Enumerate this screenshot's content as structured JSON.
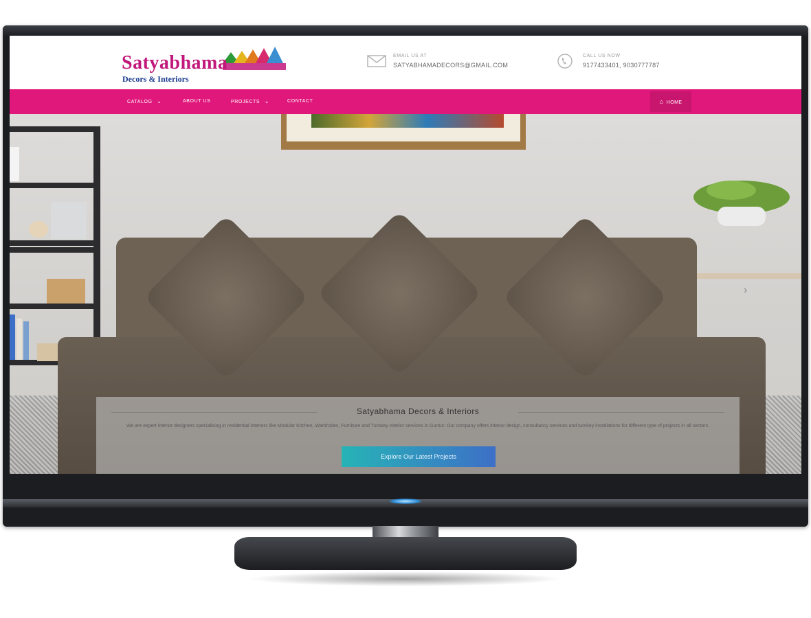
{
  "site": {
    "logo_main": "Satyabhama",
    "logo_sub": "Decors & Interiors"
  },
  "contact": {
    "email": {
      "label": "EMAIL US AT",
      "value": "SATYABHAMADECORS@GMAIL.COM"
    },
    "phone": {
      "label": "CALL US NOW",
      "value": "9177433401, 9030777787"
    }
  },
  "nav": {
    "items": [
      {
        "label": "CATALOG",
        "has_dropdown": true
      },
      {
        "label": "ABOUT US",
        "has_dropdown": false
      },
      {
        "label": "PROJECTS",
        "has_dropdown": true
      },
      {
        "label": "CONTACT",
        "has_dropdown": false
      }
    ],
    "home_label": "HOME",
    "dropdown_glyph": "⌄",
    "home_icon_glyph": "⌂"
  },
  "hero": {
    "title": "Satyabhama Decors & Interiors",
    "description": "We are expert interior designers specialising in residential interiors like Modular Kitchen, Wardrobes, Furniture and Turnkey interior services in Guntur. Our company offers interior design, consultancy services and turnkey installations for different type of projects in all sectors.",
    "cta_label": "Explore Our Latest Projects",
    "next_arrow": "›"
  },
  "colors": {
    "brand_pink": "#e0187c",
    "logo_blue": "#1a3a8f",
    "cta_start": "#27b4b6",
    "cta_end": "#3d6fc7"
  }
}
